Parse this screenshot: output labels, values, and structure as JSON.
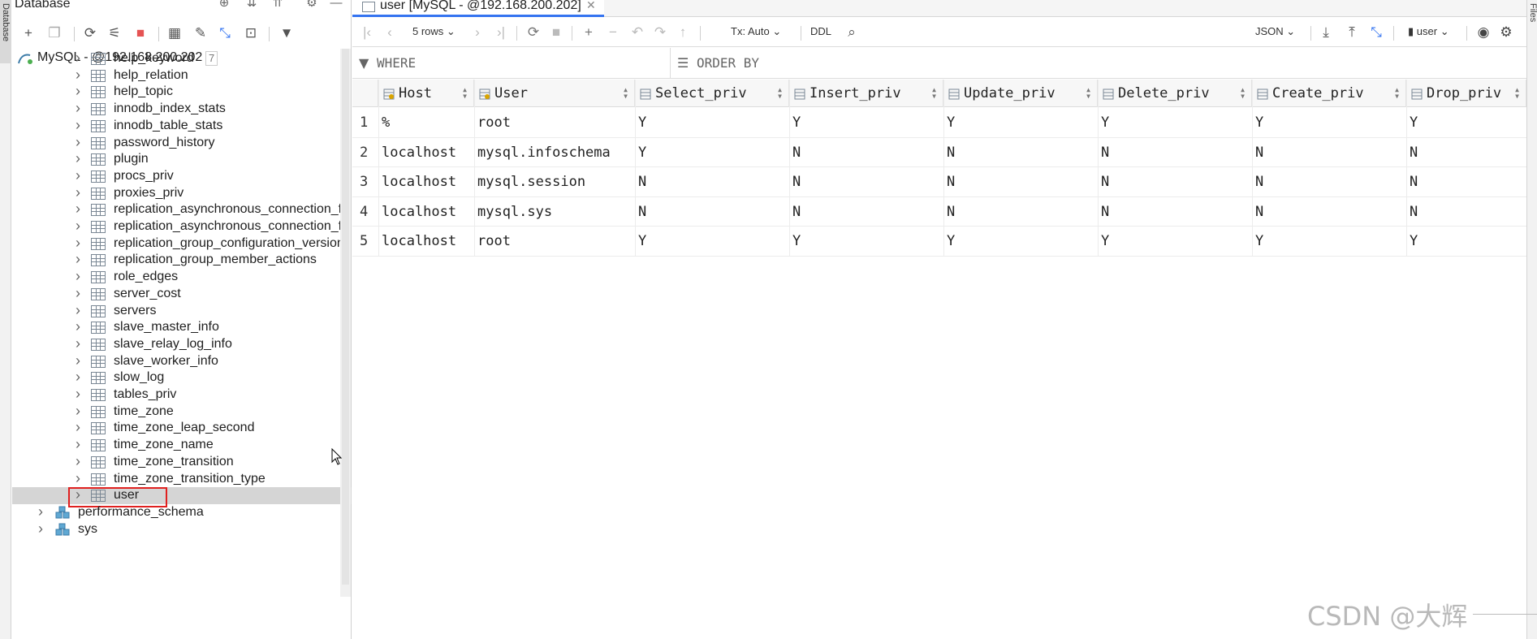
{
  "left_strip": {
    "label": "Database"
  },
  "right_strip": {
    "label": "Files"
  },
  "db_panel": {
    "title": "Database",
    "connection": {
      "label": "MySQL - @192.168.200.202",
      "badge": "7"
    },
    "tables": [
      "help_keyword",
      "help_relation",
      "help_topic",
      "innodb_index_stats",
      "innodb_table_stats",
      "password_history",
      "plugin",
      "procs_priv",
      "proxies_priv",
      "replication_asynchronous_connection_fa",
      "replication_asynchronous_connection_fa",
      "replication_group_configuration_version",
      "replication_group_member_actions",
      "role_edges",
      "server_cost",
      "servers",
      "slave_master_info",
      "slave_relay_log_info",
      "slave_worker_info",
      "slow_log",
      "tables_priv",
      "time_zone",
      "time_zone_leap_second",
      "time_zone_name",
      "time_zone_transition",
      "time_zone_transition_type",
      "user"
    ],
    "selected_table": "user",
    "schemas": [
      "performance_schema",
      "sys"
    ]
  },
  "editor": {
    "tab": {
      "label": "user [MySQL - @192.168.200.202]"
    },
    "toolbar": {
      "rows": "5 rows",
      "tx": "Tx: Auto",
      "ddl": "DDL",
      "format": "JSON",
      "schema": "user"
    },
    "filter": {
      "where": "WHERE",
      "order_by": "ORDER BY"
    },
    "grid": {
      "columns": [
        "Host",
        "User",
        "Select_priv",
        "Insert_priv",
        "Update_priv",
        "Delete_priv",
        "Create_priv",
        "Drop_priv"
      ],
      "rows": [
        {
          "num": "1",
          "cells": [
            "%",
            "root",
            "Y",
            "Y",
            "Y",
            "Y",
            "Y",
            "Y"
          ]
        },
        {
          "num": "2",
          "cells": [
            "localhost",
            "mysql.infoschema",
            "Y",
            "N",
            "N",
            "N",
            "N",
            "N"
          ]
        },
        {
          "num": "3",
          "cells": [
            "localhost",
            "mysql.session",
            "N",
            "N",
            "N",
            "N",
            "N",
            "N"
          ]
        },
        {
          "num": "4",
          "cells": [
            "localhost",
            "mysql.sys",
            "N",
            "N",
            "N",
            "N",
            "N",
            "N"
          ]
        },
        {
          "num": "5",
          "cells": [
            "localhost",
            "root",
            "Y",
            "Y",
            "Y",
            "Y",
            "Y",
            "Y"
          ]
        }
      ]
    }
  },
  "watermark": "CSDN @大辉",
  "colors": {
    "accent": "#3574f0",
    "highlight_box": "#e0201f",
    "selected_row": "#d5d5d5"
  }
}
